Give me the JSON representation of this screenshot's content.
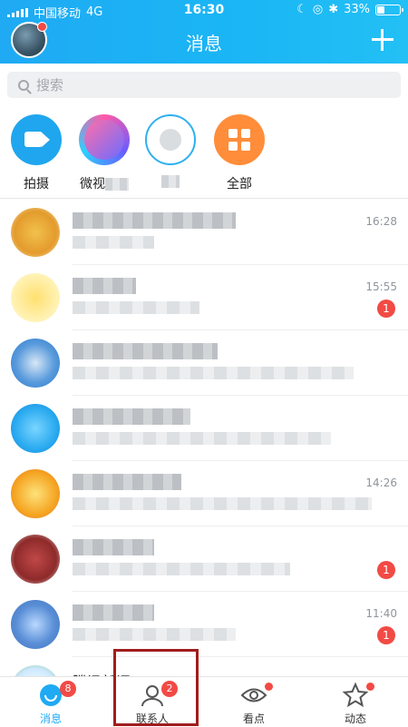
{
  "status_bar": {
    "carrier": "中国移动",
    "network": "4G",
    "time": "16:30",
    "battery": "33%"
  },
  "header": {
    "title": "消息"
  },
  "search": {
    "placeholder": "搜索"
  },
  "quick_actions": [
    {
      "label": "拍摄",
      "icon": "camera-icon"
    },
    {
      "label": "微视",
      "icon": "weishi-icon"
    },
    {
      "label": "",
      "icon": "avatar-ring-icon"
    },
    {
      "label": "全部",
      "icon": "all-apps-icon"
    }
  ],
  "conversations": [
    {
      "time": "16:28",
      "badge": ""
    },
    {
      "time": "15:55",
      "badge": "1"
    },
    {
      "time": "",
      "badge": ""
    },
    {
      "time": "",
      "badge": ""
    },
    {
      "time": "14:26",
      "badge": ""
    },
    {
      "time": "",
      "badge": "1"
    },
    {
      "time": "11:40",
      "badge": "1"
    },
    {
      "name": "腾讯新闻",
      "time": ""
    }
  ],
  "tabbar": [
    {
      "label": "消息",
      "badge": "8",
      "active": true
    },
    {
      "label": "联系人",
      "badge": "2"
    },
    {
      "label": "看点",
      "dot": true
    },
    {
      "label": "动态",
      "dot": true
    }
  ],
  "colors": {
    "accent": "#1faaf3",
    "badge": "#f24a45",
    "highlight_box": "#a01d1d"
  }
}
